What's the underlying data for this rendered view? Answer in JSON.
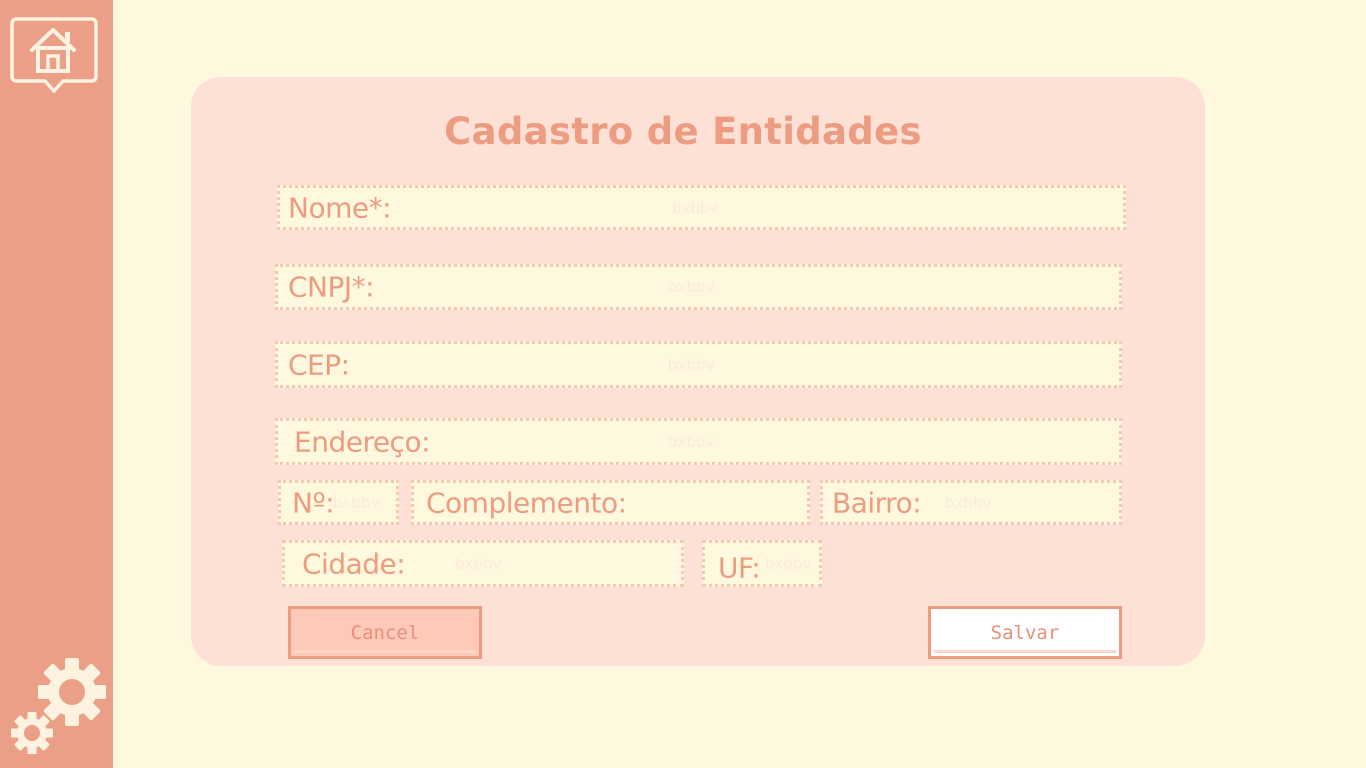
{
  "sidebar": {
    "home_icon": "home-icon",
    "settings_icon": "gears-icon"
  },
  "form": {
    "title": "Cadastro de Entidades",
    "fields": {
      "nome": {
        "label": "Nome*:",
        "placeholder": "bxbbv"
      },
      "cnpj": {
        "label": "CNPJ*:",
        "placeholder": "bxbbv"
      },
      "cep": {
        "label": "CEP:",
        "placeholder": "bxbbv"
      },
      "endereco": {
        "label": "Endereço:",
        "placeholder": "bxbbv"
      },
      "numero": {
        "label": "Nº:",
        "placeholder": "bxbbv"
      },
      "complemento": {
        "label": "Complemento:",
        "placeholder": ""
      },
      "bairro": {
        "label": "Bairro:",
        "placeholder": "bxbbv"
      },
      "cidade": {
        "label": "Cidade:",
        "placeholder": "bxbbv"
      },
      "uf": {
        "label": "UF:",
        "placeholder": "bxbbv"
      }
    },
    "buttons": {
      "cancel": "Cancel",
      "save": "Salvar"
    }
  },
  "colors": {
    "background": "#fef8df",
    "sidebar": "#eb9f86",
    "card": "#fde0d6",
    "accent": "#ec9c80"
  }
}
